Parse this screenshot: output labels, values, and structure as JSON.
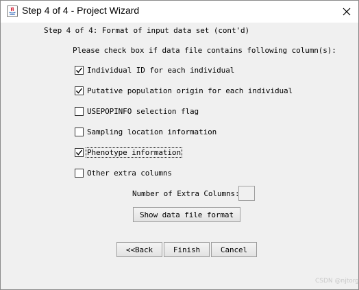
{
  "window": {
    "title": "Step 4 of 4 - Project Wizard"
  },
  "content": {
    "heading": "Step 4 of 4: Format of input data set (cont'd)",
    "instruction": "Please check box if data file contains following column(s):",
    "options": [
      {
        "label": "Individual ID for each individual",
        "checked": true
      },
      {
        "label": "Putative population origin for each individual",
        "checked": true
      },
      {
        "label": "USEPOPINFO selection flag",
        "checked": false
      },
      {
        "label": "Sampling location information",
        "checked": false
      },
      {
        "label": "Phenotype information",
        "checked": true,
        "focused": true
      },
      {
        "label": "Other extra columns",
        "checked": false
      }
    ],
    "extra_columns_label": "Number of Extra Columns:",
    "extra_columns_value": "",
    "format_button": "Show data file format"
  },
  "buttons": {
    "back": "<<Back",
    "finish": "Finish",
    "cancel": "Cancel"
  },
  "watermark": "CSDN @njtorg"
}
